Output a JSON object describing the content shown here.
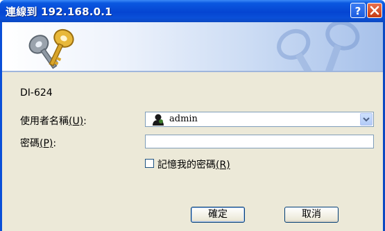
{
  "window": {
    "title": "連線到 192.168.0.1",
    "help_label": "?"
  },
  "dialog": {
    "site_name": "DI-624",
    "username_label": "使用者名稱",
    "username_mnemonic": "(U)",
    "username_colon": ":",
    "username_value": "admin",
    "password_label": "密碼",
    "password_mnemonic": "(P)",
    "password_colon": ":",
    "password_value": "",
    "remember_label": "記憶我的密碼",
    "remember_mnemonic": "(R)",
    "remember_checked": false,
    "ok_label": "確定",
    "cancel_label": "取消"
  },
  "icons": {
    "banner": "keys-icon",
    "user": "user-icon",
    "dropdown": "chevron-down-icon",
    "help": "help-icon",
    "close": "close-icon"
  }
}
